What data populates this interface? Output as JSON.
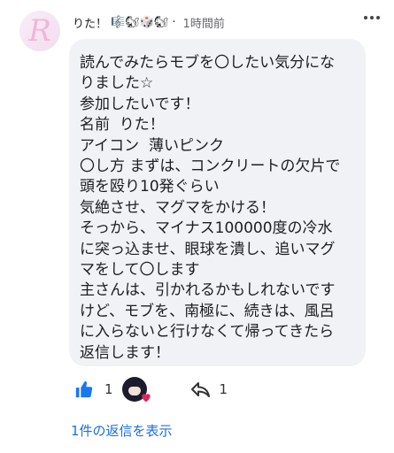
{
  "comment": {
    "author": "りた！",
    "author_decoration": "🎼🐿🎲🐿",
    "separator": "·",
    "time": "1時間前",
    "body": "読んでみたらモブを〇したい気分にな\nりました☆\n参加したいです！\n名前  りた！\nアイコン  薄いピンク\n〇し方 まずは、コンクリートの欠片で\n頭を殴り10発ぐらい\n気絶させ、マグマをかける！\nそっから、マイナス100000度の冷水\nに突っ込ませ、眼球を潰し、追いマグ\nマをして〇します\n主さんは、引かれるかもしれないです\nけど、モブを、南極に、続きは、風呂\nに入らないと行けなくて帰ってきたら\n返信します！"
  },
  "actions": {
    "like_count": "1",
    "reply_count": "1"
  },
  "replies_link": "1件の返信を表示",
  "icons": {
    "more": "more-vertical-icon",
    "like": "thumbs-up-icon",
    "reply": "reply-icon",
    "heart": "heart-icon"
  },
  "colors": {
    "accent": "#1a6fe0",
    "bubble": "#f0f2f5",
    "heart": "#e0245e"
  }
}
